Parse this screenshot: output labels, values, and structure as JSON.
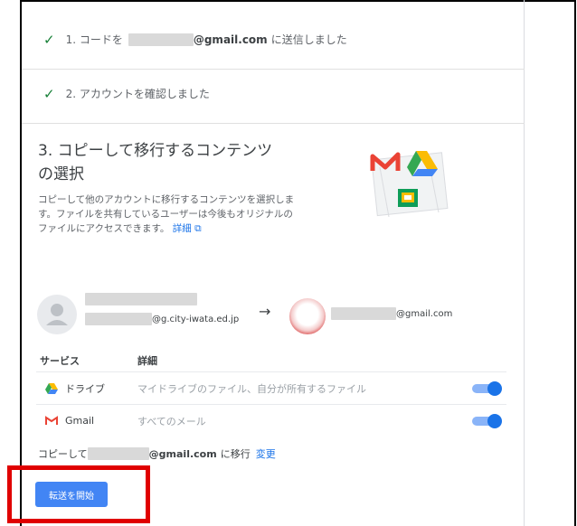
{
  "steps": [
    {
      "prefix": "1. コードを",
      "email_domain": "@gmail.com",
      "suffix": "に送信しました"
    },
    {
      "text": "2. アカウントを確認しました"
    }
  ],
  "section": {
    "title_line1": "3. コピーして移行するコンテンツ",
    "title_line2": "の選択",
    "description": "コピーして他のアカウントに移行するコンテンツを選択します。ファイルを共有しているユーザーは今後もオリジナルのファイルにアクセスできます。",
    "learn_more": "詳細"
  },
  "source_account": {
    "email_domain": "@g.city-iwata.ed.jp"
  },
  "dest_account": {
    "email_domain": "@gmail.com"
  },
  "table": {
    "col_service": "サービス",
    "col_detail": "詳細",
    "rows": [
      {
        "service": "ドライブ",
        "detail": "マイドライブのファイル、自分が所有するファイル",
        "enabled": true,
        "icon": "google-drive-icon"
      },
      {
        "service": "Gmail",
        "detail": "すべてのメール",
        "enabled": true,
        "icon": "gmail-icon"
      }
    ]
  },
  "copy_target": {
    "prefix": "コピーして",
    "email_domain": "@gmail.com",
    "suffix": "に移行",
    "change_link": "変更"
  },
  "start_button": "転送を開始",
  "colors": {
    "accent": "#1a73e8",
    "button": "#4285f4",
    "check": "#188038",
    "highlight": "#e00000"
  }
}
